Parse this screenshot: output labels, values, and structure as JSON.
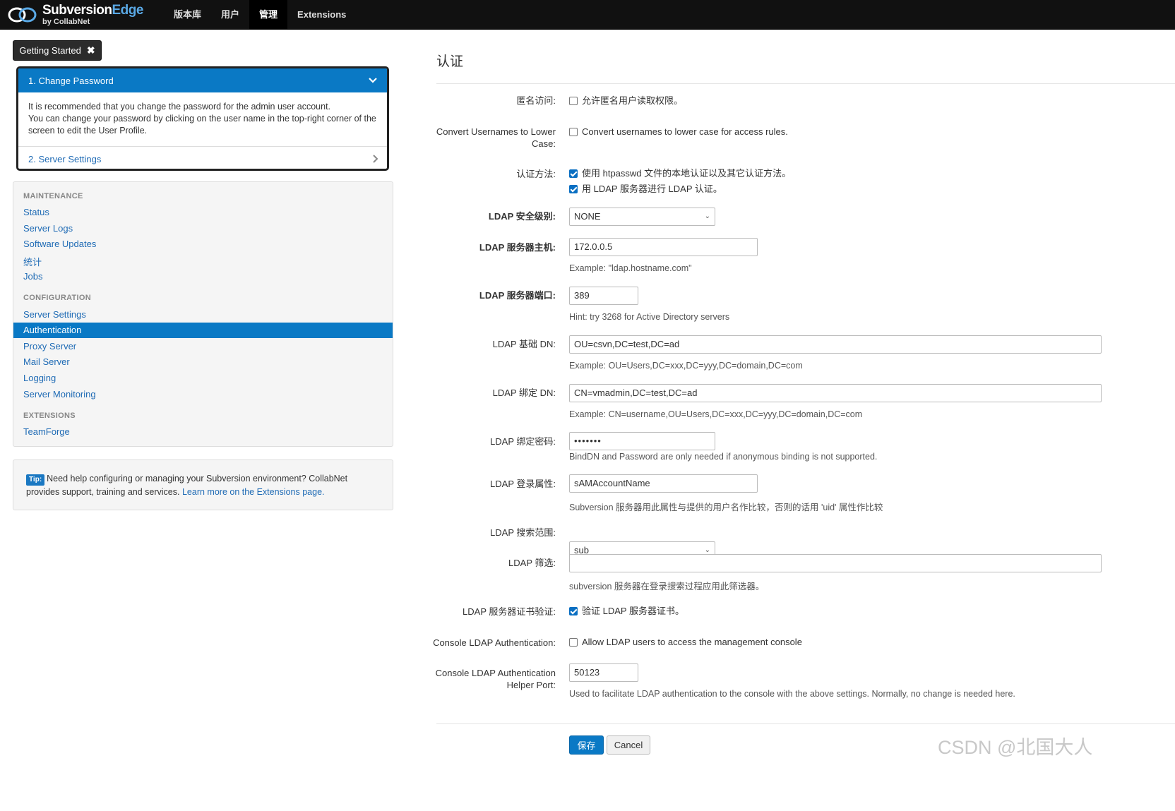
{
  "brand": {
    "name": "Subversion",
    "name_accent": "Edge",
    "sub": "by CollabNet"
  },
  "nav": [
    "版本库",
    "用户",
    "管理",
    "Extensions"
  ],
  "getting_started": {
    "button": "Getting Started",
    "close": "✖",
    "step1": "1. Change Password",
    "body_lines": [
      "It is recommended that you change the password for the admin user account.",
      "You can change your password by clicking on the user name in the top-right corner of the",
      "screen to edit the User Profile."
    ],
    "step2": "2. Server Settings"
  },
  "sidebar": {
    "maintenance_head": "MAINTENANCE",
    "maintenance": [
      "Status",
      "Server Logs",
      "Software Updates",
      "统计",
      "Jobs"
    ],
    "configuration_head": "CONFIGURATION",
    "configuration": [
      "Server Settings",
      "Authentication",
      "Proxy Server",
      "Mail Server",
      "Logging",
      "Server Monitoring"
    ],
    "extensions_head": "EXTENSIONS",
    "extensions": [
      "TeamForge"
    ]
  },
  "tip": {
    "badge": "Tip:",
    "text": "Need help configuring or managing your Subversion environment? CollabNet provides support, training and services.",
    "link": "Learn more on the Extensions page."
  },
  "form": {
    "title": "认证",
    "anon_label": "匿名访问:",
    "anon_check": "允许匿名用户读取权限。",
    "lower_label_1": "Convert Usernames to Lower",
    "lower_label_2": "Case:",
    "lower_check": "Convert usernames to lower case for access rules.",
    "auth_label": "认证方法:",
    "auth_check1": "使用 htpasswd 文件的本地认证以及其它认证方法。",
    "auth_check2": "用 LDAP 服务器进行 LDAP 认证。",
    "security_label": "LDAP 安全级别:",
    "security_value": "NONE",
    "host_label": "LDAP 服务器主机:",
    "host_value": "172.0.0.5",
    "host_hint": "Example: \"ldap.hostname.com\"",
    "port_label": "LDAP 服务器端口:",
    "port_value": "389",
    "port_hint": "Hint: try 3268 for Active Directory servers",
    "base_label": "LDAP 基础 DN:",
    "base_value": "OU=csvn,DC=test,DC=ad",
    "base_hint": "Example: OU=Users,DC=xxx,DC=yyy,DC=domain,DC=com",
    "bind_label": "LDAP 绑定 DN:",
    "bind_value": "CN=vmadmin,DC=test,DC=ad",
    "bind_hint": "Example: CN=username,OU=Users,DC=xxx,DC=yyy,DC=domain,DC=com",
    "pw_label": "LDAP 绑定密码:",
    "pw_value": "•••••••",
    "pw_hint": "BindDN and Password are only needed if anonymous binding is not supported.",
    "login_label": "LDAP 登录属性:",
    "login_value": "sAMAccountName",
    "login_hint": "Subversion 服务器用此属性与提供的用户名作比较，否则的话用 'uid' 属性作比较",
    "scope_label": "LDAP 搜索范围:",
    "scope_value": "sub",
    "filter_label": "LDAP 筛选:",
    "filter_value": "",
    "filter_hint": "subversion 服务器在登录搜索过程应用此筛选器。",
    "cert_label": "LDAP 服务器证书验证:",
    "cert_check": "验证 LDAP 服务器证书。",
    "console_label": "Console LDAP Authentication:",
    "console_check": "Allow LDAP users to access the management console",
    "helper_label_1": "Console LDAP Authentication",
    "helper_label_2": "Helper Port:",
    "helper_value": "50123",
    "helper_hint": "Used to facilitate LDAP authentication to the console with the above settings. Normally, no change is needed here.",
    "save": "保存",
    "cancel": "Cancel"
  },
  "watermark": "CSDN @北国大人"
}
